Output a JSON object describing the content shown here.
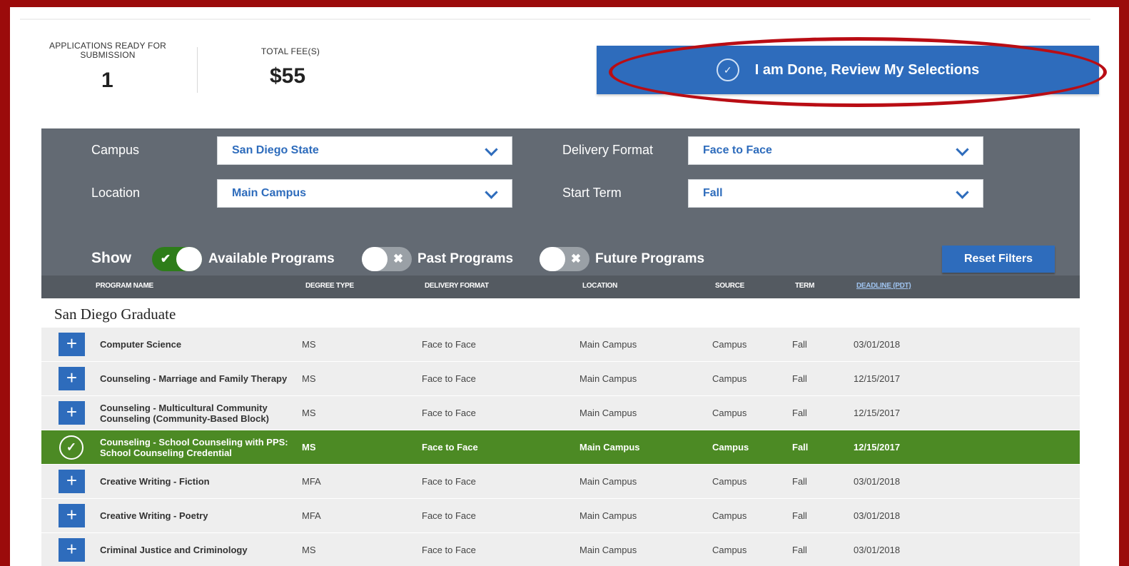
{
  "summary": {
    "ready_label": "APPLICATIONS READY FOR SUBMISSION",
    "ready_count": "1",
    "fee_label": "TOTAL FEE(S)",
    "fee_value": "$55"
  },
  "done_button": {
    "label": "I am Done, Review My Selections",
    "icon": "check-circle-icon"
  },
  "filters": {
    "campus": {
      "label": "Campus",
      "value": "San Diego State"
    },
    "location": {
      "label": "Location",
      "value": "Main Campus"
    },
    "delivery_format": {
      "label": "Delivery Format",
      "value": "Face to Face"
    },
    "start_term": {
      "label": "Start Term",
      "value": "Fall"
    },
    "show_label": "Show",
    "toggles": [
      {
        "label": "Available Programs",
        "on": true
      },
      {
        "label": "Past Programs",
        "on": false
      },
      {
        "label": "Future Programs",
        "on": false
      }
    ],
    "reset_label": "Reset Filters"
  },
  "columns": [
    "PROGRAM NAME",
    "DEGREE TYPE",
    "DELIVERY FORMAT",
    "LOCATION",
    "SOURCE",
    "TERM",
    "DEADLINE (PDT)"
  ],
  "group_title": "San Diego Graduate",
  "programs": [
    {
      "name": "Computer Science",
      "degree": "MS",
      "format": "Face to Face",
      "location": "Main Campus",
      "source": "Campus",
      "term": "Fall",
      "deadline": "03/01/2018",
      "selected": false
    },
    {
      "name": "Counseling - Marriage and Family Therapy",
      "degree": "MS",
      "format": "Face to Face",
      "location": "Main Campus",
      "source": "Campus",
      "term": "Fall",
      "deadline": "12/15/2017",
      "selected": false
    },
    {
      "name": "Counseling - Multicultural Community Counseling (Community-Based Block)",
      "degree": "MS",
      "format": "Face to Face",
      "location": "Main Campus",
      "source": "Campus",
      "term": "Fall",
      "deadline": "12/15/2017",
      "selected": false
    },
    {
      "name": "Counseling - School Counseling with PPS: School Counseling Credential",
      "degree": "MS",
      "format": "Face to Face",
      "location": "Main Campus",
      "source": "Campus",
      "term": "Fall",
      "deadline": "12/15/2017",
      "selected": true
    },
    {
      "name": "Creative Writing - Fiction",
      "degree": "MFA",
      "format": "Face to Face",
      "location": "Main Campus",
      "source": "Campus",
      "term": "Fall",
      "deadline": "03/01/2018",
      "selected": false
    },
    {
      "name": "Creative Writing - Poetry",
      "degree": "MFA",
      "format": "Face to Face",
      "location": "Main Campus",
      "source": "Campus",
      "term": "Fall",
      "deadline": "03/01/2018",
      "selected": false
    },
    {
      "name": "Criminal Justice and Criminology",
      "degree": "MS",
      "format": "Face to Face",
      "location": "Main Campus",
      "source": "Campus",
      "term": "Fall",
      "deadline": "03/01/2018",
      "selected": false
    }
  ],
  "colors": {
    "accent": "#2e6cbc",
    "selected_row": "#4c8a24",
    "frame": "#9b0b0b",
    "annotation": "#b90d14",
    "panel": "#636a73"
  }
}
